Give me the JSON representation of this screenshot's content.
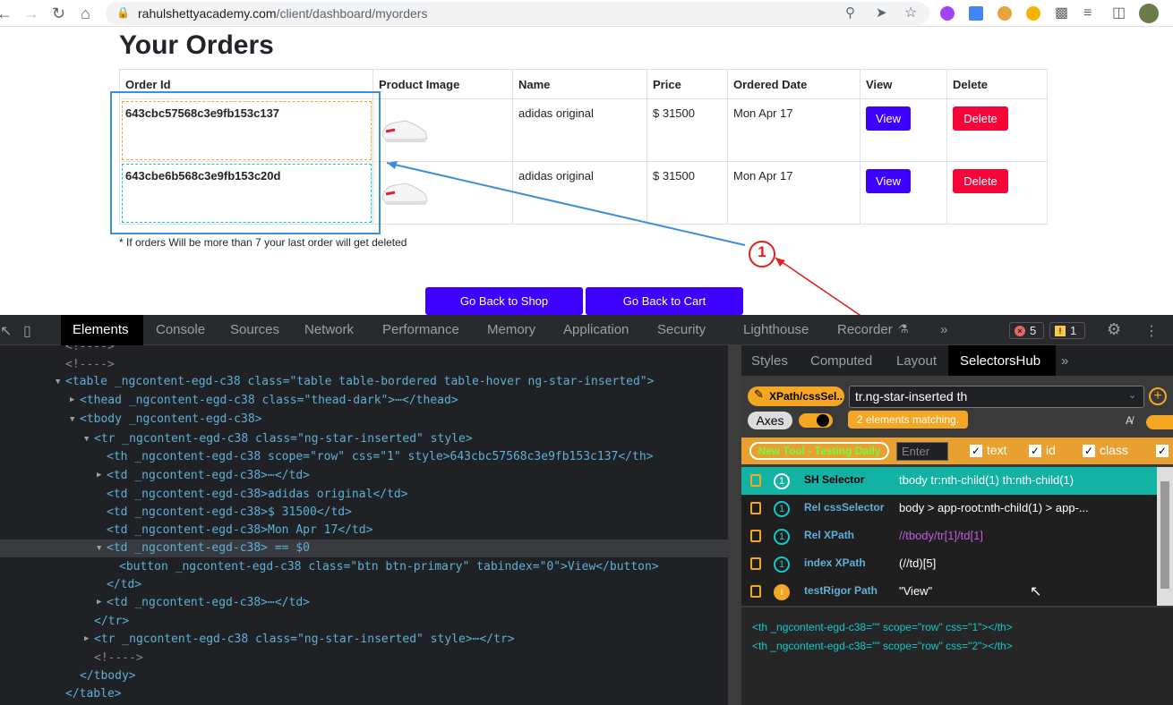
{
  "browser": {
    "url_host": "rahulshettyacademy.com",
    "url_path": "/client/dashboard/myorders"
  },
  "page": {
    "title": "Your Orders",
    "headers": [
      "Order Id",
      "Product Image",
      "Name",
      "Price",
      "Ordered Date",
      "View",
      "Delete"
    ],
    "rows": [
      {
        "id": "643cbc57568c3e9fb153c137",
        "name": "adidas original",
        "price": "$ 31500",
        "date": "Mon Apr 17",
        "view": "View",
        "del": "Delete"
      },
      {
        "id": "643cbe6b568c3e9fb153c20d",
        "name": "adidas original",
        "price": "$ 31500",
        "date": "Mon Apr 17",
        "view": "View",
        "del": "Delete"
      }
    ],
    "note": "* If orders Will be more than 7 your last order will get deleted",
    "back_shop": "Go Back to Shop",
    "back_cart": "Go Back to Cart",
    "annotation": "1"
  },
  "devtools": {
    "tabs": [
      "Elements",
      "Console",
      "Sources",
      "Network",
      "Performance",
      "Memory",
      "Application",
      "Security",
      "Lighthouse",
      "Recorder"
    ],
    "errors": "5",
    "warnings": "1",
    "side_tabs": [
      "Styles",
      "Computed",
      "Layout",
      "SelectorsHub"
    ],
    "dom": [
      "<!---->",
      "<!---->",
      "<table _ngcontent-egd-c38 class=\"table table-bordered table-hover ng-star-inserted\">",
      "<thead _ngcontent-egd-c38 class=\"thead-dark\">⋯</thead>",
      "<tbody _ngcontent-egd-c38>",
      "<tr _ngcontent-egd-c38 class=\"ng-star-inserted\" style>",
      "<th _ngcontent-egd-c38 scope=\"row\" css=\"1\" style>643cbc57568c3e9fb153c137</th>",
      "<td _ngcontent-egd-c38>⋯</td>",
      "<td _ngcontent-egd-c38>adidas original</td>",
      "<td _ngcontent-egd-c38>$ 31500</td>",
      "<td _ngcontent-egd-c38>Mon Apr 17</td>",
      "<td _ngcontent-egd-c38> == $0",
      "<button _ngcontent-egd-c38 class=\"btn btn-primary\" tabindex=\"0\">View</button>",
      "</td>",
      "<td _ngcontent-egd-c38>⋯</td>",
      "</tr>",
      "<tr _ngcontent-egd-c38 class=\"ng-star-inserted\" style>⋯</tr>",
      "<!---->",
      "</tbody>",
      "</table>"
    ],
    "sh": {
      "selector_type": "XPath/cssSel..",
      "selector_input": "tr.ng-star-inserted th",
      "axes": "Axes",
      "match": "2 elements matching.",
      "promo": "New Tool - Testing Daily",
      "enter_placeholder": "Enter",
      "checks": [
        "text",
        "id",
        "class"
      ],
      "rows": [
        {
          "label": "SH Selector",
          "num": "1",
          "value": "tbody tr:nth-child(1) th:nth-child(1)"
        },
        {
          "label": "Rel cssSelector",
          "num": "1",
          "value": "body > app-root:nth-child(1) > app-..."
        },
        {
          "label": "Rel XPath",
          "num": "1",
          "value": "//tbody/tr[1]/td[1]"
        },
        {
          "label": "index XPath",
          "num": "1",
          "value": "(//td)[5]"
        },
        {
          "label": "testRigor Path",
          "num": "i",
          "value": "\"View\""
        }
      ],
      "results": [
        "<th _ngcontent-egd-c38=\"\" scope=\"row\" css=\"1\"></th>",
        "<th _ngcontent-egd-c38=\"\" scope=\"row\" css=\"2\"></th>"
      ]
    }
  }
}
